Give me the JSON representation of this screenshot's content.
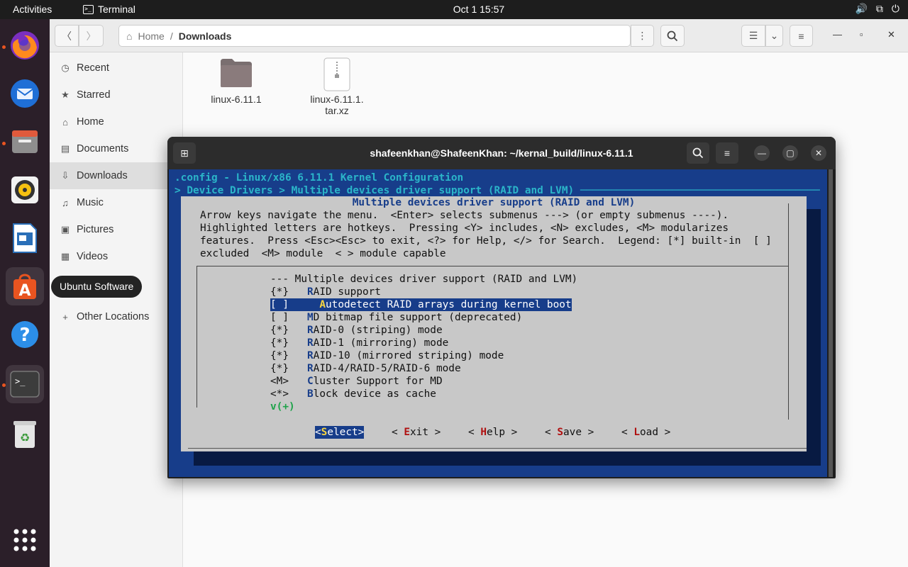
{
  "topbar": {
    "activities": "Activities",
    "app": "Terminal",
    "clock": "Oct 1  15:57",
    "tray": [
      "🔊",
      "⧉",
      "⏻"
    ]
  },
  "dock": {
    "tooltip": "Ubuntu Software"
  },
  "files": {
    "path_home": "Home",
    "path_sep": "/",
    "path_current": "Downloads",
    "sidebar": [
      {
        "label": "Recent",
        "icon": "◷"
      },
      {
        "label": "Starred",
        "icon": "★"
      },
      {
        "label": "Home",
        "icon": "⌂"
      },
      {
        "label": "Documents",
        "icon": "▤"
      },
      {
        "label": "Downloads",
        "icon": "⇩"
      },
      {
        "label": "Music",
        "icon": "♫"
      },
      {
        "label": "Pictures",
        "icon": "▣"
      },
      {
        "label": "Videos",
        "icon": "▦"
      },
      {
        "label": "Other Locations",
        "icon": "+"
      }
    ],
    "items": [
      {
        "name": "linux-6.11.1"
      },
      {
        "name_line1": "linux-6.11.1.",
        "name_line2": "tar.xz"
      }
    ]
  },
  "terminal": {
    "title": "shafeenkhan@ShafeenKhan: ~/kernal_build/linux-6.11.1",
    "header_line1": ".config - Linux/x86 6.11.1 Kernel Configuration",
    "header_line2": "> Device Drivers > Multiple devices driver support (RAID and LVM) ───────────────────────────────────────",
    "dialog_title": "Multiple devices driver support (RAID and LVM)",
    "help_lines": [
      "Arrow keys navigate the menu.  <Enter> selects submenus ---> (or empty submenus ----).",
      "Highlighted letters are hotkeys.  Pressing <Y> includes, <N> excludes, <M> modularizes",
      "features.  Press <Esc><Esc> to exit, <?> for Help, </> for Search.  Legend: [*] built-in  [ ]",
      "excluded  <M> module  < > module capable"
    ],
    "menu_header": "--- Multiple devices driver support (RAID and LVM)",
    "menu": [
      {
        "state": "{*}",
        "hot": "R",
        "rest": "AID support"
      },
      {
        "state": "[ ]",
        "hot": "A",
        "rest": "utodetect RAID arrays during kernel boot",
        "selected": true
      },
      {
        "state": "[ ]",
        "hot": "M",
        "rest": "D bitmap file support (deprecated)"
      },
      {
        "state": "{*}",
        "hot": "R",
        "rest": "AID-0 (striping) mode"
      },
      {
        "state": "{*}",
        "hot": "R",
        "rest": "AID-1 (mirroring) mode"
      },
      {
        "state": "{*}",
        "hot": "R",
        "rest": "AID-10 (mirrored striping) mode"
      },
      {
        "state": "{*}",
        "hot": "R",
        "rest": "AID-4/RAID-5/RAID-6 mode"
      },
      {
        "state": "<M>",
        "hot": "C",
        "rest": "luster Support for MD"
      },
      {
        "state": "<*>",
        "hot": "B",
        "rest": "lock device as cache"
      }
    ],
    "more": "v(+)",
    "buttons": [
      {
        "open": "<",
        "hot": "S",
        "rest": "elect",
        "close": ">"
      },
      {
        "open": "< ",
        "hot": "E",
        "rest": "xit",
        "close": " >"
      },
      {
        "open": "< ",
        "hot": "H",
        "rest": "elp",
        "close": " >"
      },
      {
        "open": "< ",
        "hot": "S",
        "rest": "ave",
        "close": " >"
      },
      {
        "open": "< ",
        "hot": "L",
        "rest": "oad",
        "close": " >"
      }
    ]
  }
}
